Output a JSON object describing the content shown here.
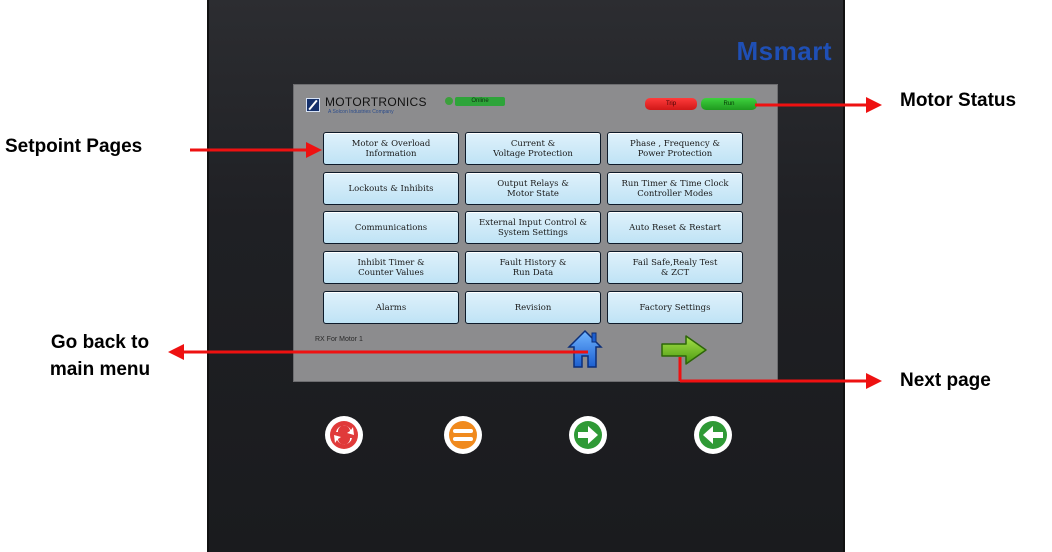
{
  "device": {
    "brand": "Msmart"
  },
  "screen": {
    "logo_text": "MOTORTRONICS",
    "logo_subtext": "A Solcon Industries Company",
    "online_label": "Online",
    "status": {
      "trip_label": "Trip",
      "run_label": "Run"
    },
    "menu": [
      {
        "label": "Motor & Overload\nInformation"
      },
      {
        "label": "Current &\nVoltage Protection"
      },
      {
        "label": "Phase , Frequency &\nPower Protection"
      },
      {
        "label": "Lockouts & Inhibits"
      },
      {
        "label": "Output Relays &\nMotor State"
      },
      {
        "label": "Run Timer & Time Clock\nController Modes"
      },
      {
        "label": "Communications"
      },
      {
        "label": "External Input Control &\nSystem Settings"
      },
      {
        "label": "Auto Reset & Restart"
      },
      {
        "label": "Inhibit Timer &\nCounter Values"
      },
      {
        "label": "Fault History &\nRun Data"
      },
      {
        "label": "Fail Safe,Realy Test\n& ZCT"
      },
      {
        "label": "Alarms"
      },
      {
        "label": "Revision"
      },
      {
        "label": "Factory Settings"
      }
    ],
    "footer_text": "RX For Motor 1",
    "home_icon": "home-icon",
    "next_icon": "arrow-right-icon"
  },
  "physical_buttons": [
    {
      "icon": "refresh-arrows-icon",
      "color": "#e03a3a"
    },
    {
      "icon": "menu-lines-icon",
      "color": "#f08a1e"
    },
    {
      "icon": "arrow-right-icon",
      "color": "#2f9a36"
    },
    {
      "icon": "arrow-left-icon",
      "color": "#2f9a36"
    }
  ],
  "callouts": {
    "setpoint_pages": "Setpoint Pages",
    "motor_status": "Motor Status",
    "go_back_line1": "Go back to",
    "go_back_line2": "main menu",
    "next_page": "Next page"
  },
  "colors": {
    "arrow_red": "#ee1111",
    "screen_button": "#c8e8f7",
    "brand_blue": "#1f4fb5"
  }
}
